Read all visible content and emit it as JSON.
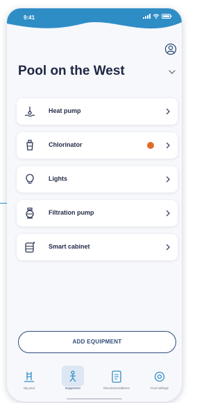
{
  "colors": {
    "header_blue": "#2f8dc6",
    "title_navy": "#1f2744",
    "accent_navy": "#2d4a78",
    "status_dot_orange": "#e06a26",
    "icon_line": "#2b3553"
  },
  "status_bar": {
    "time": "9:41",
    "icons": [
      "signal-icon",
      "wifi-icon",
      "battery-icon"
    ]
  },
  "header": {
    "pool_name": "Pool on the West",
    "profile_icon": "user-circle-icon",
    "dropdown_icon": "chevron-down-icon"
  },
  "equipment": [
    {
      "label": "Heat pump",
      "icon": "heat-pump-icon",
      "status_dot": false
    },
    {
      "label": "Chlorinator",
      "icon": "chlorinator-icon",
      "status_dot": true,
      "status_color": "#e06a26"
    },
    {
      "label": "Lights",
      "icon": "lightbulb-icon",
      "status_dot": false
    },
    {
      "label": "Filtration pump",
      "icon": "filtration-pump-icon",
      "status_dot": false
    },
    {
      "label": "Smart cabinet",
      "icon": "smart-cabinet-icon",
      "status_dot": false
    }
  ],
  "add_button": {
    "label": "ADD EQUIPMENT"
  },
  "tabs": [
    {
      "label": "My pool",
      "icon": "pool-ladder-icon",
      "active": false
    },
    {
      "label": "Equipment",
      "icon": "equipment-icon",
      "active": true
    },
    {
      "label": "Recommendations",
      "icon": "recommendations-icon",
      "active": false
    },
    {
      "label": "Pool settings",
      "icon": "settings-icon",
      "active": false
    }
  ]
}
